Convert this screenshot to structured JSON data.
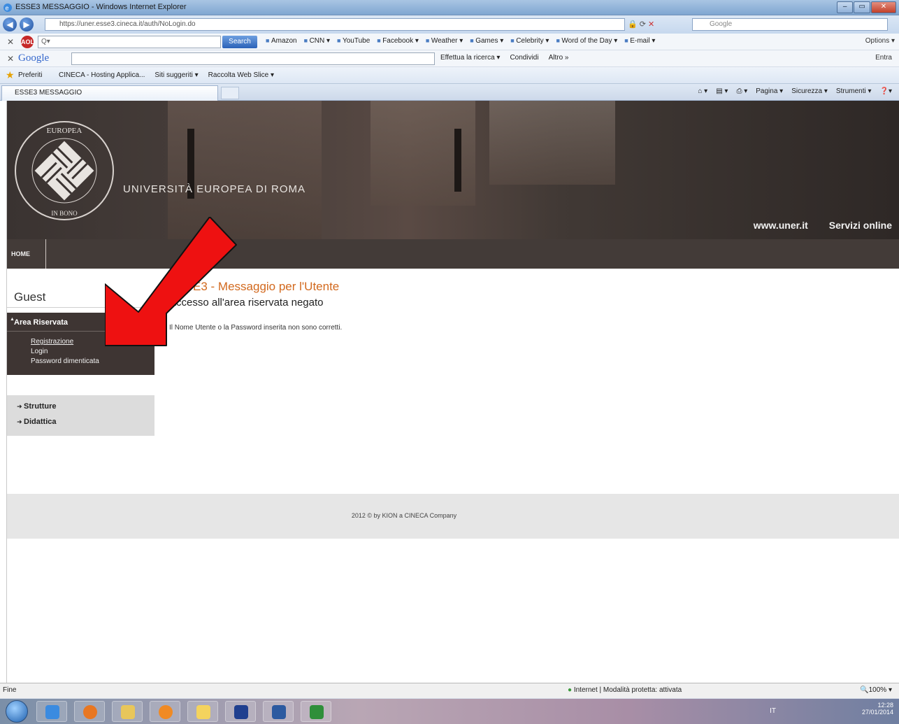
{
  "window": {
    "title": "ESSE3 MESSAGGIO - Windows Internet Explorer",
    "controls": [
      "–",
      "▭",
      "✕"
    ]
  },
  "addressbar": {
    "url": "https://uner.esse3.cineca.it/auth/NoLogin.do",
    "search_placeholder": "Google"
  },
  "aol_toolbar": {
    "logo": "AOL",
    "search_value": "Q▾",
    "search_button": "Search",
    "links": [
      "Amazon",
      "CNN ▾",
      "YouTube",
      "Facebook ▾",
      "Weather ▾",
      "Games ▾",
      "Celebrity ▾",
      "Word of the Day ▾",
      "E-mail ▾"
    ],
    "options": "Options ▾"
  },
  "google_toolbar": {
    "logo": "Google",
    "tools": [
      "Effettua la ricerca ▾",
      "Condividi",
      "Altro »"
    ],
    "signin": "Entra"
  },
  "favorites_bar": {
    "label": "Preferiti",
    "links": [
      "CINECA - Hosting Applica...",
      "Siti suggeriti ▾",
      "Raccolta Web Slice ▾"
    ]
  },
  "tabs": {
    "active": "ESSE3 MESSAGGIO"
  },
  "command_bar": [
    "Pagina ▾",
    "Sicurezza ▾",
    "Strumenti ▾"
  ],
  "header": {
    "university_name": "UNIVERSITÀ EUROPEA DI ROMA",
    "links": [
      "www.uner.it",
      "Servizi online"
    ]
  },
  "nav": {
    "home": "HOME"
  },
  "sidebar": {
    "user": "Guest",
    "area_title": "Area Riservata",
    "area_links": [
      "Registrazione",
      "Login",
      "Password dimenticata"
    ],
    "menu": [
      "Strutture",
      "Didattica"
    ]
  },
  "content": {
    "title": "ESSE3 - Messaggio per l'Utente",
    "subtitle": "Accesso all'area riservata negato",
    "message": "Il Nome Utente o la Password inserita non sono corretti."
  },
  "footer": {
    "text": "2012 © by KION a CINECA Company"
  },
  "statusbar": {
    "left": "Fine",
    "zone": "Internet | Modalità protetta: attivata",
    "zoom": "🔍100% ▾"
  },
  "taskbar": {
    "lang": "IT",
    "time": "12:28",
    "date": "27/01/2014"
  },
  "colors": {
    "header_bg": "#433b38",
    "title_accent": "#d2691e",
    "annotation_arrow": "#ee1111"
  }
}
